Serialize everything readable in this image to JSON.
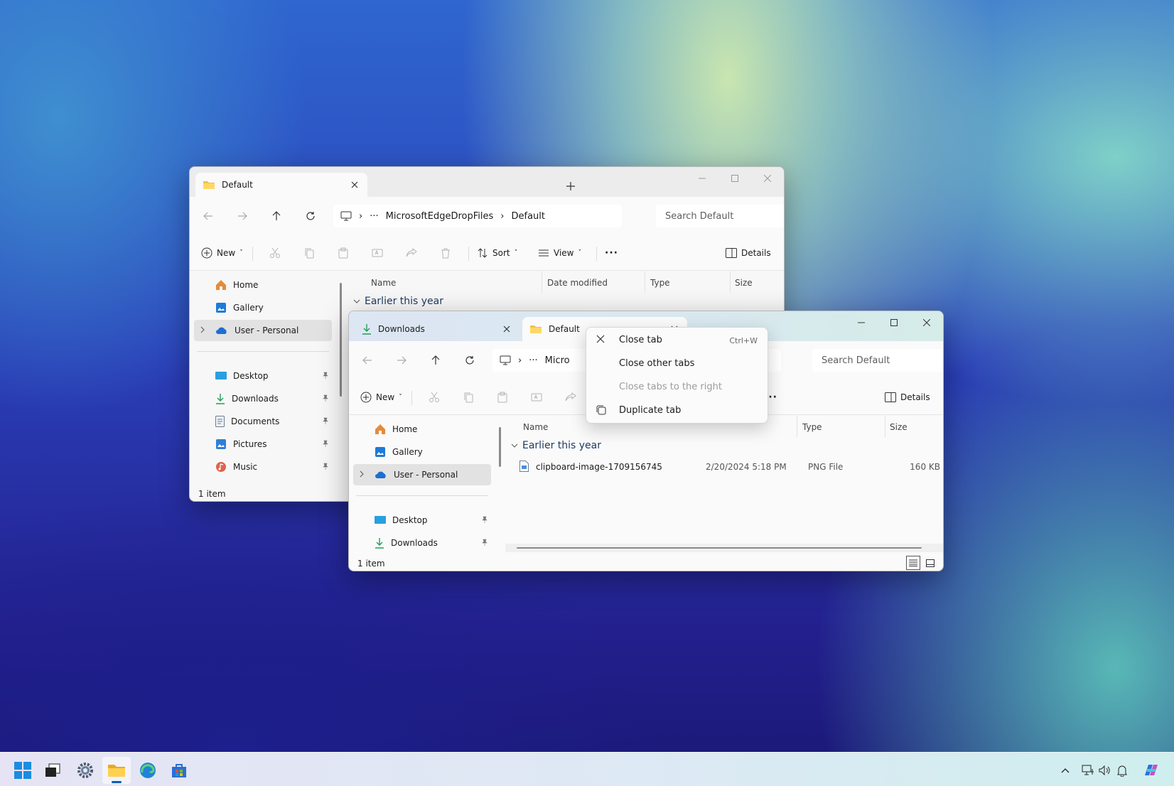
{
  "back_window": {
    "tabs": [
      {
        "label": "Default"
      }
    ],
    "address": {
      "segments": [
        "MicrosoftEdgeDropFiles",
        "Default"
      ]
    },
    "search_placeholder": "Search Default",
    "toolbar": {
      "new": "New",
      "sort": "Sort",
      "view": "View",
      "details": "Details"
    },
    "sidebar": {
      "items": [
        {
          "label": "Home"
        },
        {
          "label": "Gallery"
        },
        {
          "label": "User - Personal"
        },
        {
          "label": "Desktop"
        },
        {
          "label": "Downloads"
        },
        {
          "label": "Documents"
        },
        {
          "label": "Pictures"
        },
        {
          "label": "Music"
        }
      ]
    },
    "columns": [
      "Name",
      "Date modified",
      "Type",
      "Size"
    ],
    "group": "Earlier this year",
    "status": "1 item"
  },
  "front_window": {
    "tabs": [
      {
        "label": "Downloads"
      },
      {
        "label": "Default"
      }
    ],
    "address": {
      "segments": [
        "Micro"
      ]
    },
    "search_placeholder": "Search Default",
    "toolbar": {
      "new": "New",
      "details": "Details"
    },
    "sidebar": {
      "items": [
        {
          "label": "Home"
        },
        {
          "label": "Gallery"
        },
        {
          "label": "User - Personal"
        },
        {
          "label": "Desktop"
        },
        {
          "label": "Downloads"
        }
      ]
    },
    "columns": [
      "Name",
      "Type",
      "Size"
    ],
    "group": "Earlier this year",
    "files": [
      {
        "name": "clipboard-image-1709156745",
        "date": "2/20/2024 5:18 PM",
        "type": "PNG File",
        "size": "160 KB"
      }
    ],
    "status": "1 item"
  },
  "context_menu": {
    "items": [
      {
        "label": "Close tab",
        "shortcut": "Ctrl+W"
      },
      {
        "label": "Close other tabs"
      },
      {
        "label": "Close tabs to the right"
      },
      {
        "label": "Duplicate tab"
      }
    ]
  },
  "colors": {
    "accent": "#005fb8",
    "folder": "#f2c04b",
    "onedrive": "#1b6fd1"
  }
}
